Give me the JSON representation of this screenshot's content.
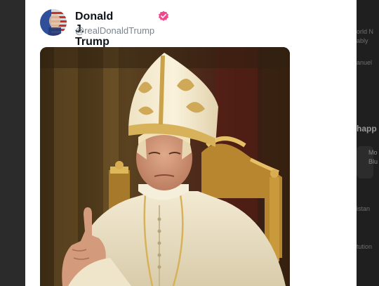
{
  "post": {
    "author": {
      "display_name": "Donald J. Trump",
      "handle": "@realDonaldTrump",
      "verified": true,
      "avatar_icon": "flag-avatar-icon",
      "verified_icon": "verified-badge-icon"
    },
    "media": {
      "type": "image",
      "icon": "pope-portrait-image"
    }
  },
  "right_panel": {
    "snippets": [
      "orld N",
      "ably",
      "anuel",
      "happ",
      "Mo",
      "Blu",
      "istan",
      "tution"
    ]
  },
  "colors": {
    "card_background": "#ffffff",
    "verified_badge": "#f0478e",
    "handle": "#7a8590",
    "dark_background": "#2a2a2a"
  }
}
